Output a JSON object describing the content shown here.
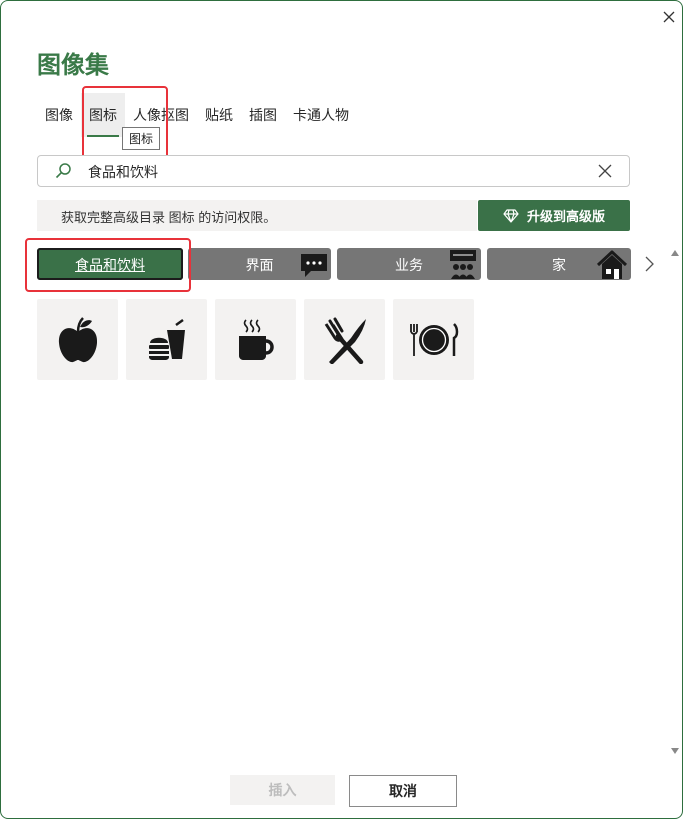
{
  "dialog": {
    "title": "图像集"
  },
  "tabs": [
    {
      "label": "图像",
      "active": false
    },
    {
      "label": "图标",
      "active": true
    },
    {
      "label": "人像抠图",
      "active": false
    },
    {
      "label": "贴纸",
      "active": false
    },
    {
      "label": "插图",
      "active": false
    },
    {
      "label": "卡通人物",
      "active": false
    }
  ],
  "tooltip": "图标",
  "search": {
    "value": "食品和饮料",
    "icon": "search-icon"
  },
  "banner": {
    "text": "获取完整高级目录 图标 的访问权限。"
  },
  "upgrade_button": {
    "label": "升级到高级版",
    "icon": "diamond-icon"
  },
  "categories": [
    {
      "label": "食品和饮料",
      "active": true
    },
    {
      "label": "界面",
      "icon": "chat-bubble-icon"
    },
    {
      "label": "业务",
      "icon": "meeting-icon"
    },
    {
      "label": "家",
      "icon": "house-icon"
    }
  ],
  "icons": [
    "apple-icon",
    "fast-food-icon",
    "coffee-cup-icon",
    "fork-knife-icon",
    "plate-utensils-icon"
  ],
  "buttons": {
    "insert": "插入",
    "cancel": "取消"
  },
  "colors": {
    "accent": "#3a7148",
    "title": "#3a7a48",
    "category_bg": "#767676",
    "highlight": "#e8323a"
  }
}
